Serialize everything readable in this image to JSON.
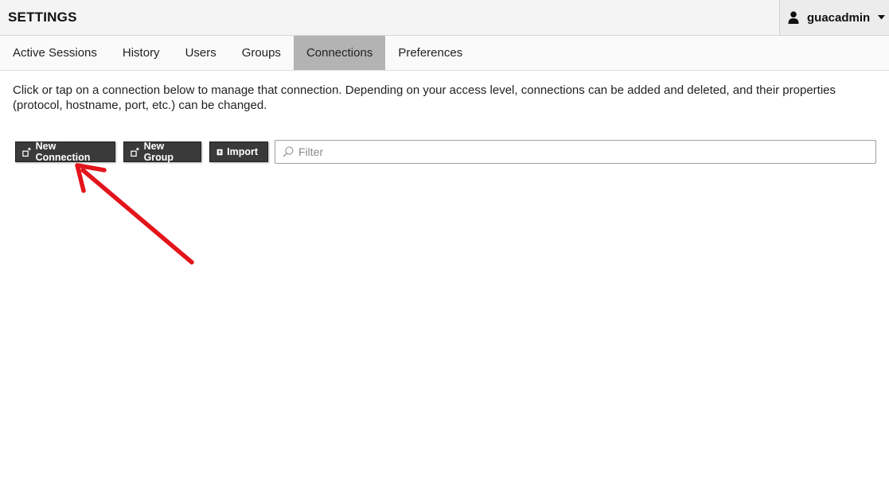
{
  "header": {
    "title": "SETTINGS",
    "user": {
      "name": "guacadmin",
      "icon": "user-icon",
      "caret_icon": "caret-down-icon"
    }
  },
  "tabs": [
    {
      "label": "Active Sessions",
      "active": false
    },
    {
      "label": "History",
      "active": false
    },
    {
      "label": "Users",
      "active": false
    },
    {
      "label": "Groups",
      "active": false
    },
    {
      "label": "Connections",
      "active": true
    },
    {
      "label": "Preferences",
      "active": false
    }
  ],
  "description": "Click or tap on a connection below to manage that connection. Depending on your access level, connections can be added and deleted, and their properties (protocol, hostname, port, etc.) can be changed.",
  "toolbar": {
    "new_connection": {
      "label": "New Connection",
      "icon": "add-connection-icon"
    },
    "new_group": {
      "label": "New Group",
      "icon": "add-group-icon"
    },
    "import": {
      "label": "Import",
      "icon": "upload-icon"
    },
    "filter": {
      "placeholder": "Filter",
      "value": "",
      "icon": "search-icon"
    }
  },
  "annotation": {
    "color": "#e3141b",
    "target": "new-connection-button"
  },
  "colors": {
    "header_bg": "#f4f4f4",
    "active_tab_bg": "#b3b3b3",
    "button_bg": "#3a3a3a"
  }
}
